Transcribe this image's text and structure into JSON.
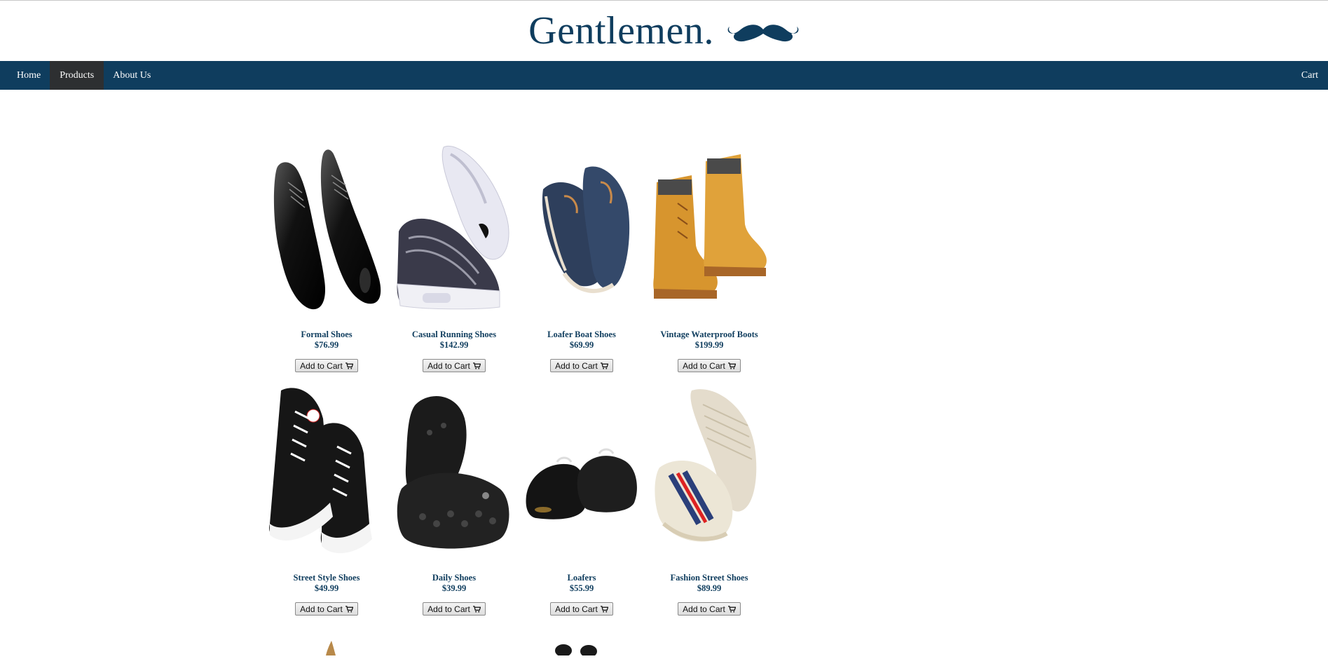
{
  "header": {
    "brand": "Gentlemen.",
    "logo_icon": "mustache-icon",
    "brand_color": "#0f3d5e"
  },
  "nav": {
    "items": [
      {
        "label": "Home",
        "active": false
      },
      {
        "label": "Products",
        "active": true
      },
      {
        "label": "About Us",
        "active": false
      }
    ],
    "cart_label": "Cart",
    "bar_color": "#0f3d5e",
    "active_color": "#2d2f31"
  },
  "products": [
    {
      "name": "Formal Shoes",
      "price": "$76.99",
      "button": "Add to Cart"
    },
    {
      "name": "Casual Running Shoes",
      "price": "$142.99",
      "button": "Add to Cart"
    },
    {
      "name": "Loafer Boat Shoes",
      "price": "$69.99",
      "button": "Add to Cart"
    },
    {
      "name": "Vintage Waterproof Boots",
      "price": "$199.99",
      "button": "Add to Cart"
    },
    {
      "name": "Street Style Shoes",
      "price": "$49.99",
      "button": "Add to Cart"
    },
    {
      "name": "Daily Shoes",
      "price": "$39.99",
      "button": "Add to Cart"
    },
    {
      "name": "Loafers",
      "price": "$55.99",
      "button": "Add to Cart"
    },
    {
      "name": "Fashion Street Shoes",
      "price": "$89.99",
      "button": "Add to Cart"
    }
  ]
}
